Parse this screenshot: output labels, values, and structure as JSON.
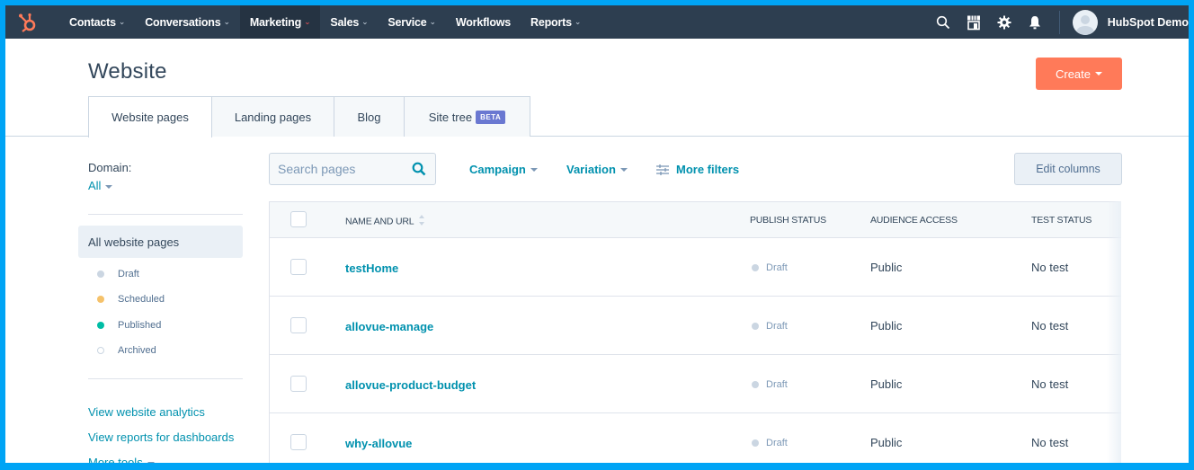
{
  "topnav": {
    "items": [
      {
        "label": "Contacts",
        "chevron": "⌄",
        "active": false
      },
      {
        "label": "Conversations",
        "chevron": "⌄",
        "active": false
      },
      {
        "label": "Marketing",
        "chevron": "⌄",
        "active": true
      },
      {
        "label": "Sales",
        "chevron": "⌄",
        "active": false
      },
      {
        "label": "Service",
        "chevron": "⌄",
        "active": false
      },
      {
        "label": "Workflows",
        "chevron": "",
        "active": false
      },
      {
        "label": "Reports",
        "chevron": "⌄",
        "active": false
      }
    ],
    "icons": [
      "search-icon",
      "marketplace-icon",
      "settings-gear-icon",
      "notifications-bell-icon"
    ],
    "account_name": "HubSpot Demo"
  },
  "header": {
    "title": "Website",
    "create_label": "Create",
    "tabs": [
      {
        "label": "Website pages",
        "active": true
      },
      {
        "label": "Landing pages",
        "active": false
      },
      {
        "label": "Blog",
        "active": false
      },
      {
        "label": "Site tree",
        "badge": "BETA",
        "active": false
      }
    ]
  },
  "sidebar": {
    "domain_label": "Domain:",
    "domain_value": "All",
    "all_pages_label": "All website pages",
    "statuses": [
      {
        "label": "Draft",
        "color": "#cbd6e2"
      },
      {
        "label": "Scheduled",
        "color": "#f5c26b"
      },
      {
        "label": "Published",
        "color": "#00bda5"
      },
      {
        "label": "Archived",
        "color": "#ffffff"
      }
    ],
    "links": [
      "View website analytics",
      "View reports for dashboards",
      "More tools"
    ]
  },
  "toolbar": {
    "search_placeholder": "Search pages",
    "campaign_label": "Campaign",
    "variation_label": "Variation",
    "more_filters_label": "More filters",
    "edit_columns_label": "Edit columns"
  },
  "table": {
    "columns": [
      "NAME AND URL",
      "PUBLISH STATUS",
      "AUDIENCE ACCESS",
      "TEST STATUS"
    ],
    "rows": [
      {
        "name": "testHome",
        "publish_status": "Draft",
        "audience": "Public",
        "test": "No test"
      },
      {
        "name": "allovue-manage",
        "publish_status": "Draft",
        "audience": "Public",
        "test": "No test"
      },
      {
        "name": "allovue-product-budget",
        "publish_status": "Draft",
        "audience": "Public",
        "test": "No test"
      },
      {
        "name": "why-allovue",
        "publish_status": "Draft",
        "audience": "Public",
        "test": "No test"
      }
    ]
  },
  "colors": {
    "nav_bg": "#2d3e50",
    "accent_orange": "#ff7a59",
    "link_teal": "#0091ae",
    "beta_badge": "#6a78d1",
    "frame_blue": "#00a4f5"
  }
}
